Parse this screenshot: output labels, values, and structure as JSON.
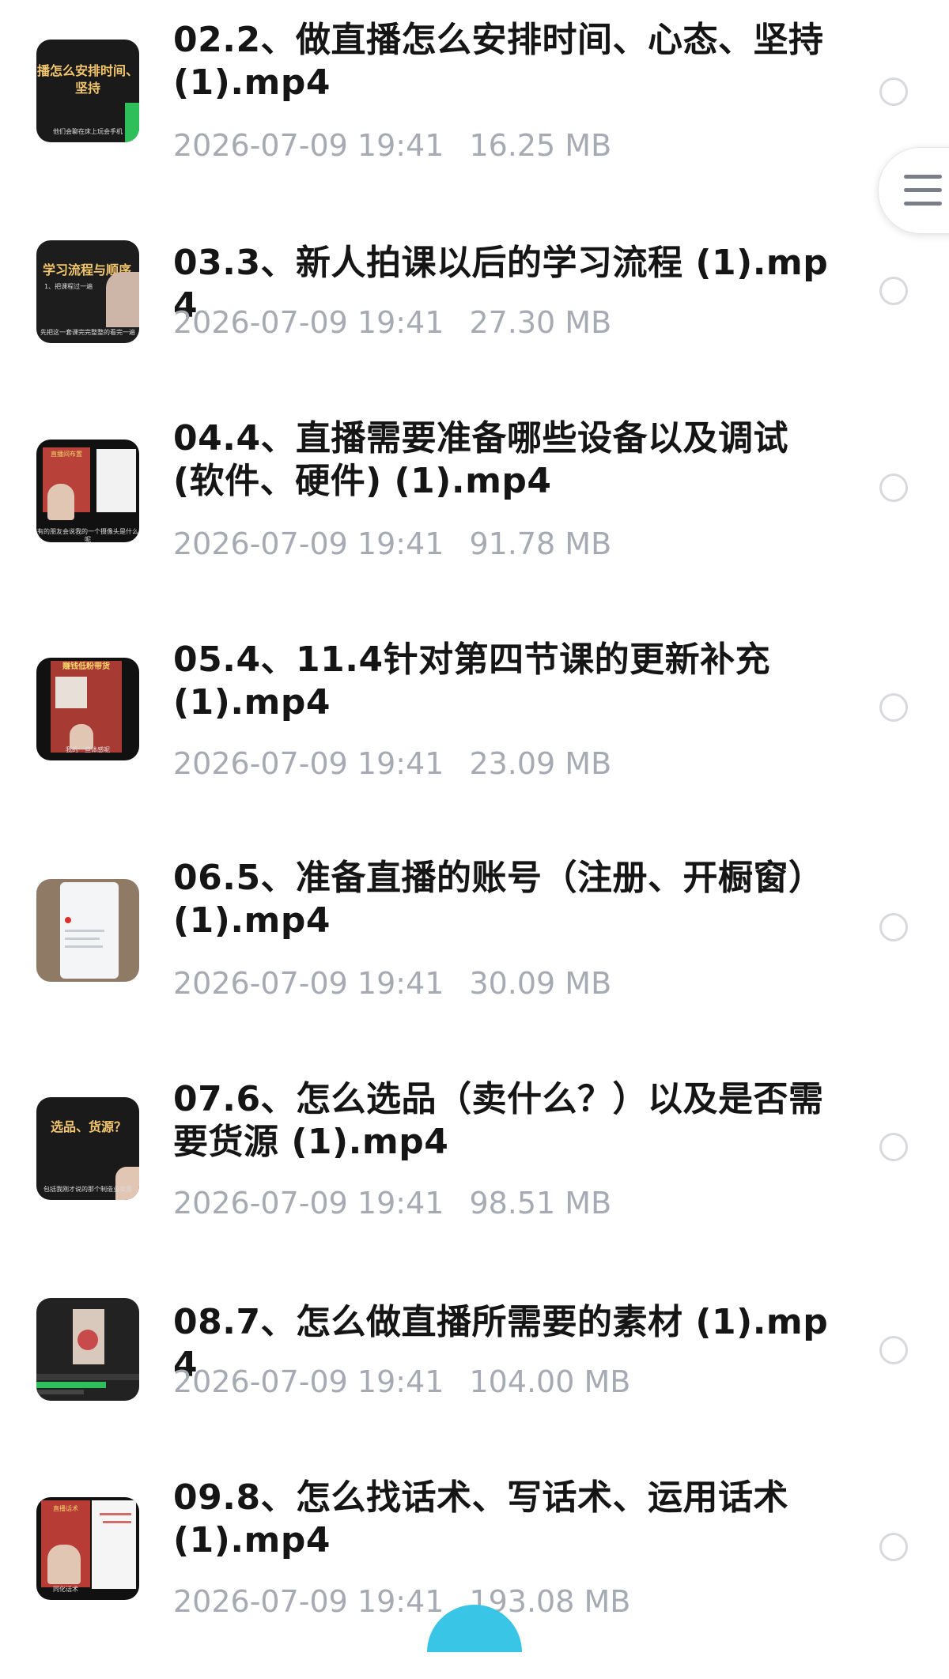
{
  "files": [
    {
      "title": "02.2、做直播怎么安排时间、心态、坚持(1).mp4",
      "date": "2026-07-09 19:41",
      "size": "16.25 MB",
      "thumb": {
        "line1": "播怎么安排时间、",
        "line2": "坚持",
        "caption": "他们会聊在床上玩会手机"
      }
    },
    {
      "title": "03.3、新人拍课以后的学习流程 (1).mp4",
      "date": "2026-07-09 19:41",
      "size": "27.30 MB",
      "thumb": {
        "line1": "学习流程与顺序",
        "line2": "1、把课程过一遍",
        "caption": "先把这一套课完完整整的看完一遍"
      }
    },
    {
      "title": "04.4、直播需要准备哪些设备以及调试(软件、硬件) (1).mp4",
      "date": "2026-07-09 19:41",
      "size": "91.78 MB",
      "thumb": {
        "line1": "直播间布置",
        "line2": "",
        "caption": "有的朋友会说我的一个摄像头是什么呢"
      }
    },
    {
      "title": "05.4、11.4针对第四节课的更新补充 (1).mp4",
      "date": "2026-07-09 19:41",
      "size": "23.09 MB",
      "thumb": {
        "line1": "赚钱低粉带货",
        "line2": "",
        "caption": "我的一些体感呢"
      }
    },
    {
      "title": "06.5、准备直播的账号（注册、开橱窗）(1).mp4",
      "date": "2026-07-09 19:41",
      "size": "30.09 MB",
      "thumb": {
        "line1": "",
        "line2": "",
        "caption": ""
      }
    },
    {
      "title": "07.6、怎么选品（卖什么？）以及是否需要货源 (1).mp4",
      "date": "2026-07-09 19:41",
      "size": "98.51 MB",
      "thumb": {
        "line1": "选品、货源？",
        "line2": "",
        "caption": "包括我刚才说的那个制造业卖货"
      }
    },
    {
      "title": "08.7、怎么做直播所需要的素材 (1).mp4",
      "date": "2026-07-09 19:41",
      "size": "104.00 MB",
      "thumb": {
        "line1": "",
        "line2": "",
        "caption": ""
      }
    },
    {
      "title": "09.8、怎么找话术、写话术、运用话术 (1).mp4",
      "date": "2026-07-09 19:41",
      "size": "193.08 MB",
      "thumb": {
        "line1": "直播话术",
        "line2": "",
        "caption": "同化话术"
      }
    }
  ],
  "colors": {
    "title": "#151515",
    "meta": "#a6abb3",
    "checkbox_border": "#d7d9dd",
    "accent": "#39c5e6"
  },
  "icons": {
    "float_menu": "hamburger-menu-icon",
    "checkbox": "radio-circle-icon"
  }
}
